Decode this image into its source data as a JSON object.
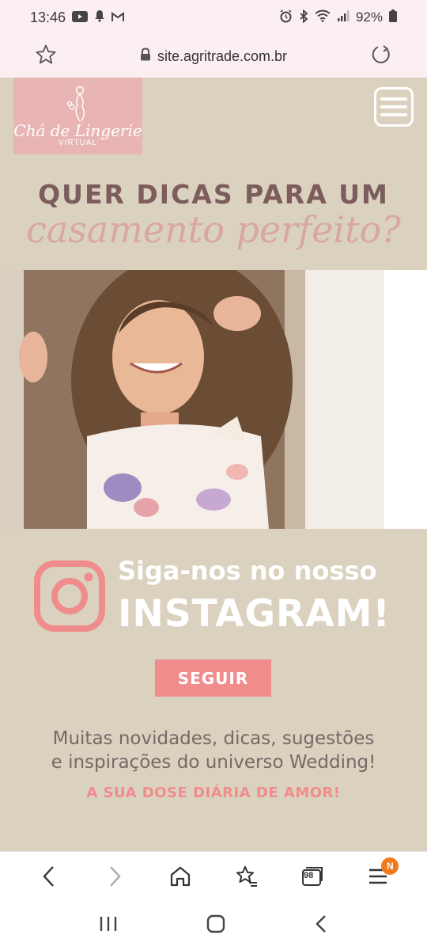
{
  "status_bar": {
    "time": "13:46",
    "battery": "92%",
    "icons_left": [
      "youtube-icon",
      "notification-bell-icon",
      "gmail-icon"
    ],
    "icons_right": [
      "alarm-icon",
      "bluetooth-icon",
      "wifi-icon",
      "signal-icon",
      "battery-icon"
    ]
  },
  "url_bar": {
    "url": "site.agritrade.com.br",
    "icons": [
      "favorite-star-icon",
      "lock-icon",
      "reload-icon"
    ]
  },
  "header": {
    "logo_name": "Chá de Lingerie",
    "logo_sub": "VIRTUAL",
    "menu_icon": "hamburger-menu-icon"
  },
  "hero": {
    "headline": "QUER DICAS PARA UM",
    "script_line": "casamento perfeito?"
  },
  "instagram": {
    "line1": "Siga-nos no nosso",
    "line2": "INSTAGRAM!",
    "button_label": "SEGUIR",
    "description_1": "Muitas novidades, dicas, sugestões",
    "description_2": "e inspirações do universo Wedding!",
    "tagline": "A SUA DOSE DIÁRIA DE AMOR!"
  },
  "browser_bar": {
    "tabs_count": "98",
    "menu_badge": "N"
  },
  "colors": {
    "page_bg": "#dbd1bf",
    "logo_bg": "#e8b4b4",
    "headline": "#7c5c5c",
    "script": "#d8a79f",
    "accent": "#f08c8c"
  }
}
